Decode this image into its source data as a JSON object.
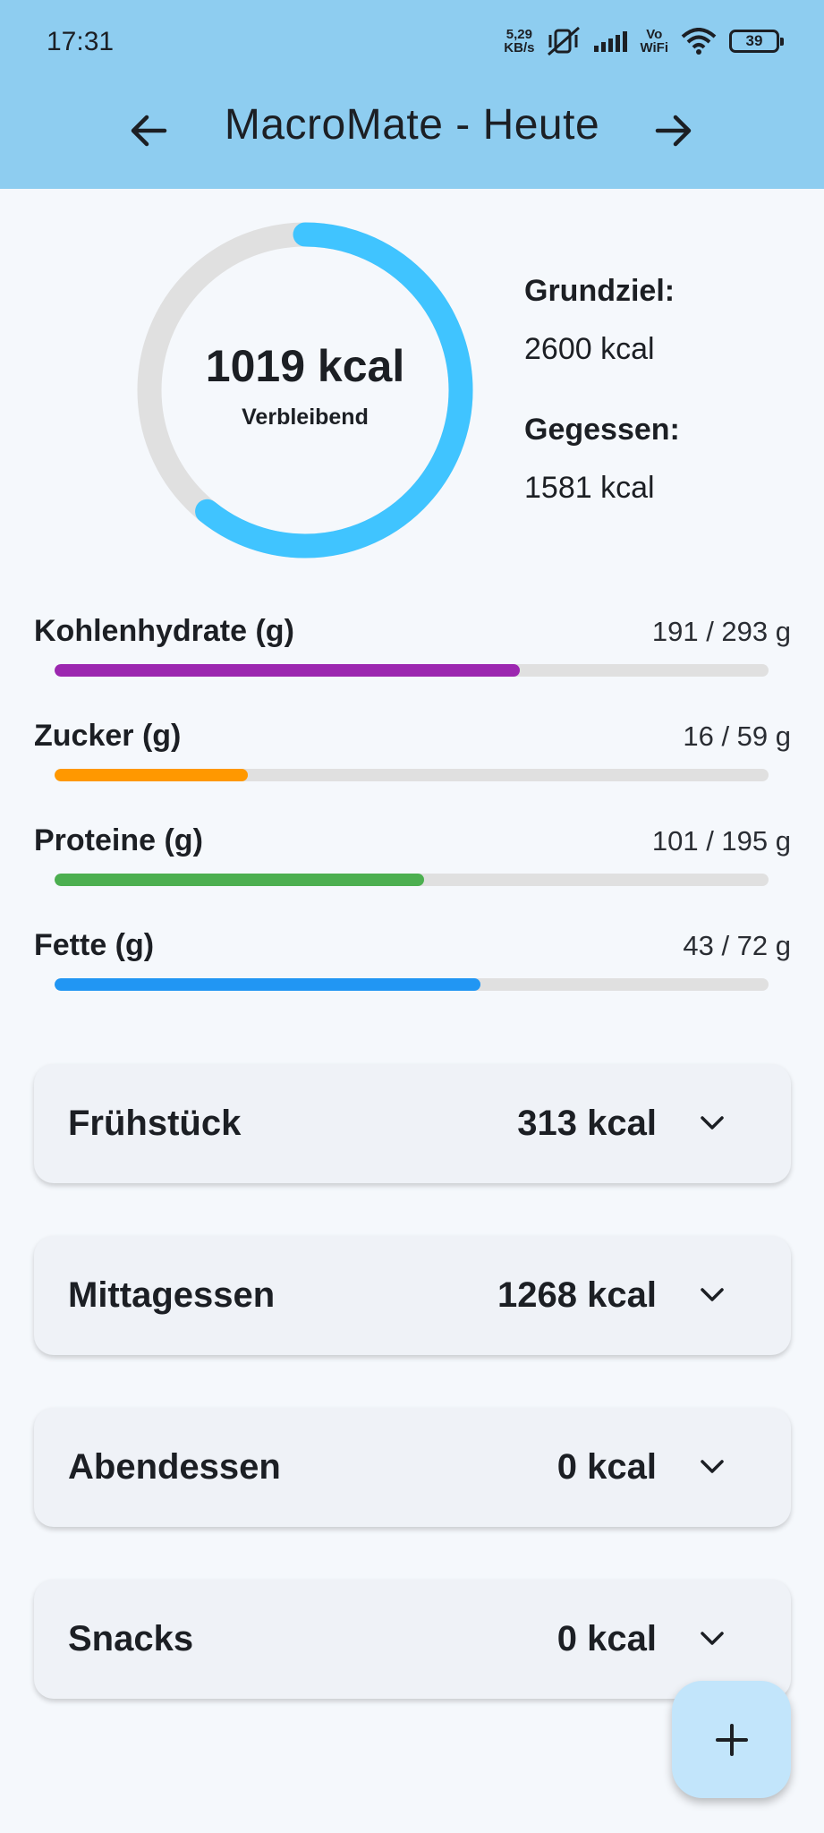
{
  "status_bar": {
    "time": "17:31",
    "net_speed_value": "5,29",
    "net_speed_unit": "KB/s",
    "vowifi_top": "Vo",
    "vowifi_bottom": "WiFi",
    "battery": "39"
  },
  "app_bar": {
    "title": "MacroMate - Heute",
    "back_icon": "arrow-left-icon",
    "forward_icon": "arrow-right-icon"
  },
  "summary": {
    "remaining_value": "1019 kcal",
    "remaining_label": "Verbleibend",
    "goal_label": "Grundziel:",
    "goal_value": "2600 kcal",
    "eaten_label": "Gegessen:",
    "eaten_value": "1581 kcal",
    "eaten_fraction": 0.608,
    "ring_color": "#40c4ff",
    "ring_track_color": "#e0e0e0"
  },
  "macros": [
    {
      "name": "Kohlenhydrate (g)",
      "amount": "191 / 293 g",
      "fraction": 0.652,
      "color": "#9c27b0"
    },
    {
      "name": "Zucker (g)",
      "amount": "16 / 59 g",
      "fraction": 0.271,
      "color": "#ff9800"
    },
    {
      "name": "Proteine (g)",
      "amount": "101 / 195 g",
      "fraction": 0.518,
      "color": "#4caf50"
    },
    {
      "name": "Fette (g)",
      "amount": "43 / 72 g",
      "fraction": 0.597,
      "color": "#2196f3"
    }
  ],
  "meals": [
    {
      "name": "Frühstück",
      "kcal": "313 kcal"
    },
    {
      "name": "Mittagessen",
      "kcal": "1268 kcal"
    },
    {
      "name": "Abendessen",
      "kcal": "0 kcal"
    },
    {
      "name": "Snacks",
      "kcal": "0 kcal"
    }
  ],
  "fab": {
    "icon": "plus-icon"
  }
}
